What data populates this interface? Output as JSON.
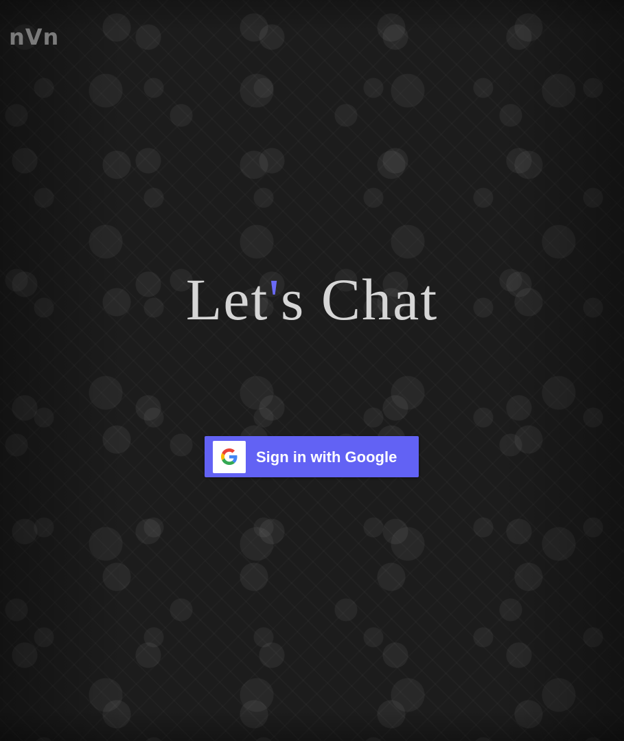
{
  "app": {
    "logo_text": "nVn"
  },
  "hero": {
    "title_before": "Let",
    "title_apostrophe": "'",
    "title_after": "s Chat"
  },
  "signin": {
    "button_label": "Sign in with Google",
    "icon": "google-g-icon",
    "button_color": "#6262f4"
  },
  "colors": {
    "background": "#1c1c1c",
    "title": "#d6d6d6",
    "accent": "#6a6af6"
  }
}
